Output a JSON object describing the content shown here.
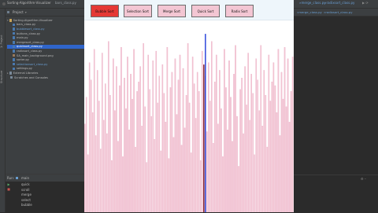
{
  "ide": {
    "title": "Sorting-Algorithm-Visualizer",
    "tab_file": "bars_class.py",
    "right_tab_1": "»merge_class.py",
    "right_tab_2": "»radixsort_class.py"
  },
  "project_panel": {
    "label": "Project",
    "root": "Sorting-Algorithm-Visualizer",
    "files": [
      {
        "name": "bars_class.py",
        "color": "#bbbbbb"
      },
      {
        "name": "bubblesort_class.py",
        "color": "#6a9fd4"
      },
      {
        "name": "buttons_class.py",
        "color": "#bbbbbb"
      },
      {
        "name": "main.py",
        "color": "#bbbbbb"
      },
      {
        "name": "mergesort_class.py",
        "color": "#bbbbbb"
      },
      {
        "name": "quicksort_class.py",
        "color": "#6a9fd4",
        "selected": true
      },
      {
        "name": "radixsort_class.py",
        "color": "#bbbbbb"
      },
      {
        "name": "SA_main_background.png",
        "color": "#bbbbbb"
      },
      {
        "name": "sorter.py",
        "color": "#bbbbbb"
      },
      {
        "name": "selectionsort_class.py",
        "color": "#6a9fd4"
      },
      {
        "name": "settings.py",
        "color": "#bbbbbb"
      }
    ],
    "extra_items": [
      "External Libraries",
      "Scratches and Consoles"
    ]
  },
  "run_panel": {
    "label": "Run:",
    "config": "main",
    "lines": [
      "quick",
      "scroll",
      "merge",
      "select",
      "bubble"
    ]
  },
  "visualizer": {
    "buttons": [
      {
        "label": "Bubble Sort",
        "active": true
      },
      {
        "label": "Selection Sort",
        "active": false
      },
      {
        "label": "Merge Sort",
        "active": false
      },
      {
        "label": "Quick Sort",
        "active": false
      },
      {
        "label": "Radix Sort",
        "active": false
      }
    ],
    "colors": {
      "bar": "#f3c6d3",
      "bar_edge": "#e9a6c0",
      "highlight_blue": "#1e3ad8",
      "highlight_dark": "#7a1020",
      "active_button": "#e53935"
    },
    "bar_values": [
      0.46,
      0.6,
      0.3,
      0.78,
      0.69,
      0.52,
      0.85,
      0.4,
      0.74,
      0.58,
      0.33,
      0.83,
      0.48,
      0.67,
      0.41,
      0.89,
      0.61,
      0.27,
      0.8,
      0.53,
      0.76,
      0.37,
      0.66,
      0.86,
      0.29,
      0.7,
      0.54,
      0.81,
      0.43,
      0.72,
      0.59,
      0.85,
      0.34,
      0.63,
      0.68,
      0.76,
      0.45,
      0.88,
      0.55,
      0.26,
      0.82,
      0.64,
      0.5,
      0.79,
      0.38,
      0.84,
      0.57,
      0.71,
      0.32,
      0.77,
      0.62,
      0.47,
      0.86,
      0.28,
      0.65,
      0.73,
      0.39,
      0.8,
      0.51,
      0.69,
      0.82,
      0.35,
      0.75,
      0.44,
      0.61,
      0.88,
      0.57,
      0.31,
      0.81,
      0.67,
      0.49,
      0.73,
      0.63,
      0.27,
      0.84,
      0.53,
      0.71,
      0.42,
      0.78,
      0.58,
      0.89,
      0.36,
      0.68,
      0.82,
      0.46,
      0.74,
      0.54,
      0.29,
      0.85,
      0.65,
      0.43,
      0.79,
      0.6,
      0.37,
      0.72,
      0.87,
      0.5,
      0.24,
      0.64,
      0.7,
      0.41,
      0.76,
      0.56,
      0.83,
      0.48,
      0.72,
      0.62,
      0.3,
      0.8,
      0.69,
      0.53,
      0.87,
      0.45,
      0.74,
      0.61,
      0.34,
      0.82,
      0.58,
      0.68,
      0.78,
      0.66,
      0.52,
      0.85,
      0.4,
      0.73,
      0.59,
      0.86,
      0.55,
      0.8,
      0.47,
      0.63,
      0.81
    ],
    "highlight_blue_index": 76,
    "highlight_dark_index": 75,
    "highlight_blue_value": 0.93,
    "highlight_dark_value": 0.77
  }
}
